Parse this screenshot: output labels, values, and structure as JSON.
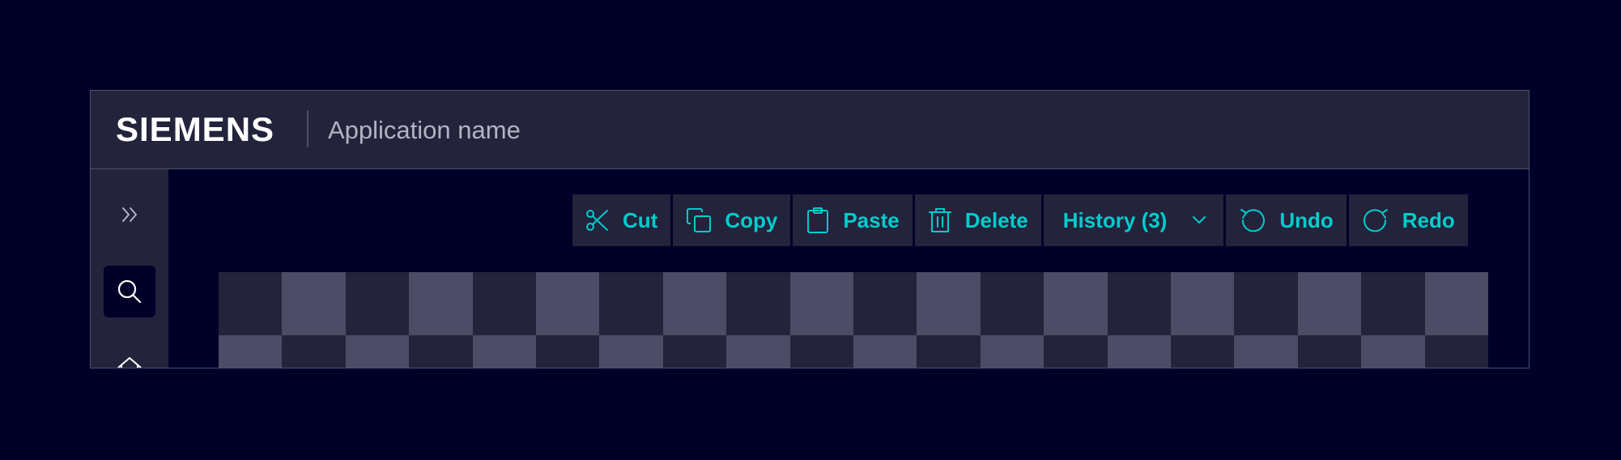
{
  "header": {
    "brand": "SIEMENS",
    "app_name": "Application name"
  },
  "sidebar": {
    "items": [
      {
        "icon": "double-chevron-right-icon"
      },
      {
        "icon": "search-icon"
      },
      {
        "icon": "home-icon"
      }
    ]
  },
  "toolbar": {
    "cut": "Cut",
    "copy": "Copy",
    "paste": "Paste",
    "delete": "Delete",
    "history": "History (3)",
    "undo": "Undo",
    "redo": "Redo"
  },
  "colors": {
    "background": "#000028",
    "panel": "#23233c",
    "accent": "#00cccc",
    "border": "#4d4f6e",
    "checker_light": "#4d4c66"
  }
}
